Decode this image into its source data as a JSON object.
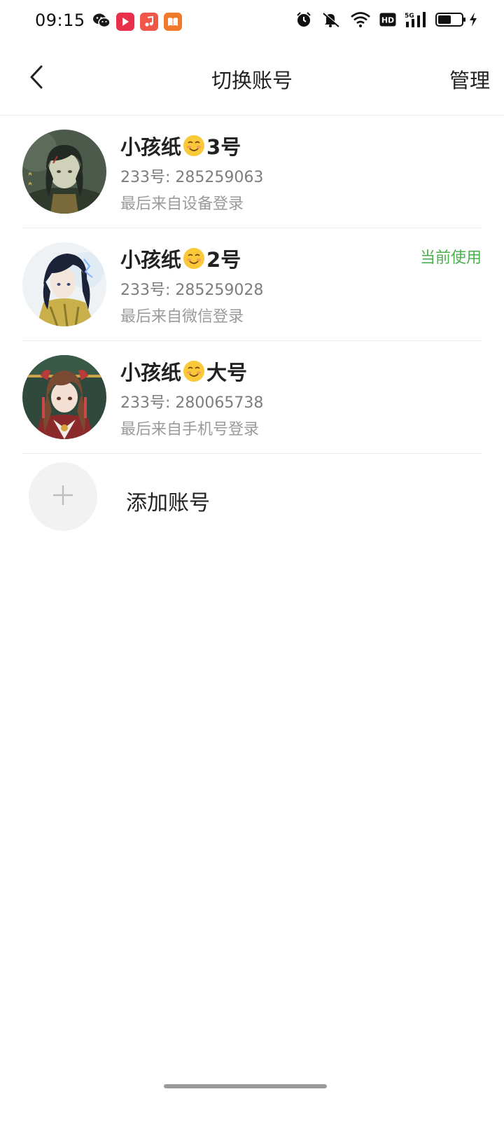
{
  "status_bar": {
    "time": "09:15",
    "left_icons": [
      "wechat-icon",
      "video-app-icon",
      "music-app-icon",
      "reading-app-icon"
    ],
    "right_icons": [
      "alarm-icon",
      "mute-icon",
      "wifi-icon",
      "hd-icon",
      "signal-5g-icon",
      "battery-icon",
      "charging-icon"
    ],
    "hd_label": "HD",
    "network_label": "5G"
  },
  "nav": {
    "back_icon": "chevron-left-icon",
    "title": "切换账号",
    "manage_label": "管理"
  },
  "accounts": [
    {
      "name_prefix": "小孩纸",
      "name_emoji": "smiling-face-emoji",
      "name_suffix": "3号",
      "id_text": "233号: 285259063",
      "login_text": "最后来自设备登录",
      "current": ""
    },
    {
      "name_prefix": "小孩纸",
      "name_emoji": "smiling-face-emoji",
      "name_suffix": "2号",
      "id_text": "233号: 285259028",
      "login_text": "最后来自微信登录",
      "current": "当前使用"
    },
    {
      "name_prefix": "小孩纸",
      "name_emoji": "smiling-face-emoji",
      "name_suffix": "大号",
      "id_text": "233号: 280065738",
      "login_text": "最后来自手机号登录",
      "current": ""
    }
  ],
  "add_account": {
    "icon": "plus-icon",
    "label": "添加账号"
  },
  "colors": {
    "accent_green": "#4caf50",
    "text_primary": "#222222",
    "text_secondary": "#7d7d7d",
    "divider": "#ededed"
  }
}
